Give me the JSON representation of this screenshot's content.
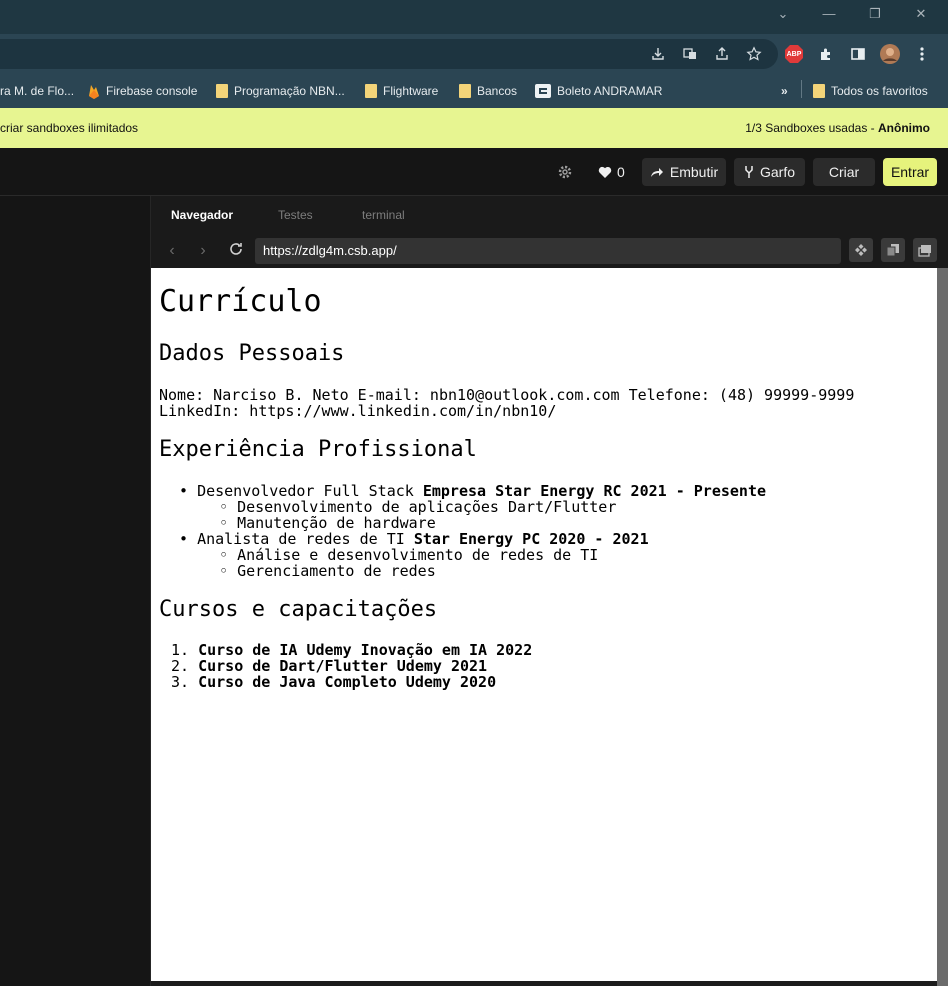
{
  "window": {
    "controls": [
      "⌄",
      "—",
      "❐",
      "✕"
    ]
  },
  "toolbar": {
    "abp_label": "ABP"
  },
  "bookmarks": {
    "items": [
      "ra M. de Flo...",
      "Firebase console",
      "Programação NBN...",
      "Flightware",
      "Bancos",
      "Boleto ANDRAMAR"
    ],
    "overflow": "»",
    "all_label": "Todos os favoritos"
  },
  "banner": {
    "left_text": "criar sandboxes ilimitados",
    "usage_text": "1/3 Sandboxes usadas - ",
    "user_text": "Anônimo"
  },
  "header": {
    "likes": "0",
    "embed_label": "Embutir",
    "fork_label": "Garfo",
    "create_label": "Criar",
    "login_label": "Entrar"
  },
  "preview_tabs": [
    "Navegador",
    "Testes",
    "terminal"
  ],
  "nav": {
    "url": "https://zdlg4m.csb.app/"
  },
  "page": {
    "title": "Currículo",
    "personal": {
      "heading": "Dados Pessoais",
      "line1": "Nome: Narciso B. Neto E-mail: nbn10@outlook.com.com Telefone: (48) 99999-9999",
      "line2": "LinkedIn: https://www.linkedin.com/in/nbn10/"
    },
    "experience": {
      "heading": "Experiência Profissional",
      "jobs": [
        {
          "role": "Desenvolvedor Full Stack ",
          "company": "Empresa Star Energy RC 2021 - Presente",
          "tasks": [
            "Desenvolvimento de aplicações Dart/Flutter",
            "Manutenção de hardware"
          ]
        },
        {
          "role": "Analista de redes de TI ",
          "company": "Star Energy PC 2020 - 2021",
          "tasks": [
            "Análise e desenvolvimento de redes de TI",
            "Gerenciamento de redes"
          ]
        }
      ]
    },
    "courses": {
      "heading": "Cursos e capacitações",
      "items": [
        "Curso de IA Udemy Inovação em IA 2022",
        "Curso de Dart/Flutter Udemy 2021",
        "Curso de Java Completo Udemy 2020"
      ],
      "numbers": [
        "1.",
        "2.",
        "3."
      ]
    }
  }
}
